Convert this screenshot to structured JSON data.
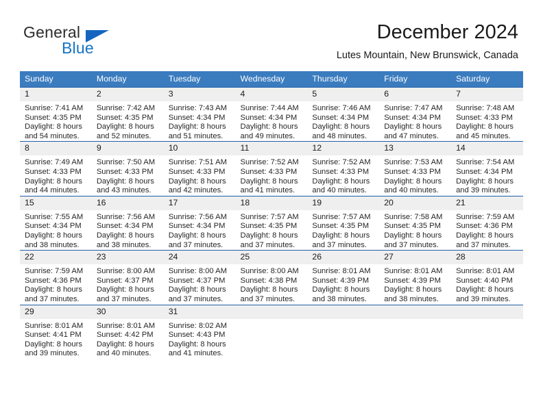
{
  "brand": {
    "name_part1": "General",
    "name_part2": "Blue",
    "triangle_color": "#1565c0",
    "blue_color": "#1474c4"
  },
  "header": {
    "title": "December 2024",
    "location": "Lutes Mountain, New Brunswick, Canada"
  },
  "colors": {
    "header_bar": "#3b7cbf",
    "row_rule": "#1f5fa8",
    "daynum_strip": "#efefef"
  },
  "weekday_headers": [
    "Sunday",
    "Monday",
    "Tuesday",
    "Wednesday",
    "Thursday",
    "Friday",
    "Saturday"
  ],
  "weeks": [
    [
      {
        "day": "1",
        "sunrise": "Sunrise: 7:41 AM",
        "sunset": "Sunset: 4:35 PM",
        "daylight1": "Daylight: 8 hours",
        "daylight2": "and 54 minutes."
      },
      {
        "day": "2",
        "sunrise": "Sunrise: 7:42 AM",
        "sunset": "Sunset: 4:35 PM",
        "daylight1": "Daylight: 8 hours",
        "daylight2": "and 52 minutes."
      },
      {
        "day": "3",
        "sunrise": "Sunrise: 7:43 AM",
        "sunset": "Sunset: 4:34 PM",
        "daylight1": "Daylight: 8 hours",
        "daylight2": "and 51 minutes."
      },
      {
        "day": "4",
        "sunrise": "Sunrise: 7:44 AM",
        "sunset": "Sunset: 4:34 PM",
        "daylight1": "Daylight: 8 hours",
        "daylight2": "and 49 minutes."
      },
      {
        "day": "5",
        "sunrise": "Sunrise: 7:46 AM",
        "sunset": "Sunset: 4:34 PM",
        "daylight1": "Daylight: 8 hours",
        "daylight2": "and 48 minutes."
      },
      {
        "day": "6",
        "sunrise": "Sunrise: 7:47 AM",
        "sunset": "Sunset: 4:34 PM",
        "daylight1": "Daylight: 8 hours",
        "daylight2": "and 47 minutes."
      },
      {
        "day": "7",
        "sunrise": "Sunrise: 7:48 AM",
        "sunset": "Sunset: 4:33 PM",
        "daylight1": "Daylight: 8 hours",
        "daylight2": "and 45 minutes."
      }
    ],
    [
      {
        "day": "8",
        "sunrise": "Sunrise: 7:49 AM",
        "sunset": "Sunset: 4:33 PM",
        "daylight1": "Daylight: 8 hours",
        "daylight2": "and 44 minutes."
      },
      {
        "day": "9",
        "sunrise": "Sunrise: 7:50 AM",
        "sunset": "Sunset: 4:33 PM",
        "daylight1": "Daylight: 8 hours",
        "daylight2": "and 43 minutes."
      },
      {
        "day": "10",
        "sunrise": "Sunrise: 7:51 AM",
        "sunset": "Sunset: 4:33 PM",
        "daylight1": "Daylight: 8 hours",
        "daylight2": "and 42 minutes."
      },
      {
        "day": "11",
        "sunrise": "Sunrise: 7:52 AM",
        "sunset": "Sunset: 4:33 PM",
        "daylight1": "Daylight: 8 hours",
        "daylight2": "and 41 minutes."
      },
      {
        "day": "12",
        "sunrise": "Sunrise: 7:52 AM",
        "sunset": "Sunset: 4:33 PM",
        "daylight1": "Daylight: 8 hours",
        "daylight2": "and 40 minutes."
      },
      {
        "day": "13",
        "sunrise": "Sunrise: 7:53 AM",
        "sunset": "Sunset: 4:33 PM",
        "daylight1": "Daylight: 8 hours",
        "daylight2": "and 40 minutes."
      },
      {
        "day": "14",
        "sunrise": "Sunrise: 7:54 AM",
        "sunset": "Sunset: 4:34 PM",
        "daylight1": "Daylight: 8 hours",
        "daylight2": "and 39 minutes."
      }
    ],
    [
      {
        "day": "15",
        "sunrise": "Sunrise: 7:55 AM",
        "sunset": "Sunset: 4:34 PM",
        "daylight1": "Daylight: 8 hours",
        "daylight2": "and 38 minutes."
      },
      {
        "day": "16",
        "sunrise": "Sunrise: 7:56 AM",
        "sunset": "Sunset: 4:34 PM",
        "daylight1": "Daylight: 8 hours",
        "daylight2": "and 38 minutes."
      },
      {
        "day": "17",
        "sunrise": "Sunrise: 7:56 AM",
        "sunset": "Sunset: 4:34 PM",
        "daylight1": "Daylight: 8 hours",
        "daylight2": "and 37 minutes."
      },
      {
        "day": "18",
        "sunrise": "Sunrise: 7:57 AM",
        "sunset": "Sunset: 4:35 PM",
        "daylight1": "Daylight: 8 hours",
        "daylight2": "and 37 minutes."
      },
      {
        "day": "19",
        "sunrise": "Sunrise: 7:57 AM",
        "sunset": "Sunset: 4:35 PM",
        "daylight1": "Daylight: 8 hours",
        "daylight2": "and 37 minutes."
      },
      {
        "day": "20",
        "sunrise": "Sunrise: 7:58 AM",
        "sunset": "Sunset: 4:35 PM",
        "daylight1": "Daylight: 8 hours",
        "daylight2": "and 37 minutes."
      },
      {
        "day": "21",
        "sunrise": "Sunrise: 7:59 AM",
        "sunset": "Sunset: 4:36 PM",
        "daylight1": "Daylight: 8 hours",
        "daylight2": "and 37 minutes."
      }
    ],
    [
      {
        "day": "22",
        "sunrise": "Sunrise: 7:59 AM",
        "sunset": "Sunset: 4:36 PM",
        "daylight1": "Daylight: 8 hours",
        "daylight2": "and 37 minutes."
      },
      {
        "day": "23",
        "sunrise": "Sunrise: 8:00 AM",
        "sunset": "Sunset: 4:37 PM",
        "daylight1": "Daylight: 8 hours",
        "daylight2": "and 37 minutes."
      },
      {
        "day": "24",
        "sunrise": "Sunrise: 8:00 AM",
        "sunset": "Sunset: 4:37 PM",
        "daylight1": "Daylight: 8 hours",
        "daylight2": "and 37 minutes."
      },
      {
        "day": "25",
        "sunrise": "Sunrise: 8:00 AM",
        "sunset": "Sunset: 4:38 PM",
        "daylight1": "Daylight: 8 hours",
        "daylight2": "and 37 minutes."
      },
      {
        "day": "26",
        "sunrise": "Sunrise: 8:01 AM",
        "sunset": "Sunset: 4:39 PM",
        "daylight1": "Daylight: 8 hours",
        "daylight2": "and 38 minutes."
      },
      {
        "day": "27",
        "sunrise": "Sunrise: 8:01 AM",
        "sunset": "Sunset: 4:39 PM",
        "daylight1": "Daylight: 8 hours",
        "daylight2": "and 38 minutes."
      },
      {
        "day": "28",
        "sunrise": "Sunrise: 8:01 AM",
        "sunset": "Sunset: 4:40 PM",
        "daylight1": "Daylight: 8 hours",
        "daylight2": "and 39 minutes."
      }
    ],
    [
      {
        "day": "29",
        "sunrise": "Sunrise: 8:01 AM",
        "sunset": "Sunset: 4:41 PM",
        "daylight1": "Daylight: 8 hours",
        "daylight2": "and 39 minutes."
      },
      {
        "day": "30",
        "sunrise": "Sunrise: 8:01 AM",
        "sunset": "Sunset: 4:42 PM",
        "daylight1": "Daylight: 8 hours",
        "daylight2": "and 40 minutes."
      },
      {
        "day": "31",
        "sunrise": "Sunrise: 8:02 AM",
        "sunset": "Sunset: 4:43 PM",
        "daylight1": "Daylight: 8 hours",
        "daylight2": "and 41 minutes."
      },
      {
        "day": "",
        "sunrise": "",
        "sunset": "",
        "daylight1": "",
        "daylight2": ""
      },
      {
        "day": "",
        "sunrise": "",
        "sunset": "",
        "daylight1": "",
        "daylight2": ""
      },
      {
        "day": "",
        "sunrise": "",
        "sunset": "",
        "daylight1": "",
        "daylight2": ""
      },
      {
        "day": "",
        "sunrise": "",
        "sunset": "",
        "daylight1": "",
        "daylight2": ""
      }
    ]
  ]
}
